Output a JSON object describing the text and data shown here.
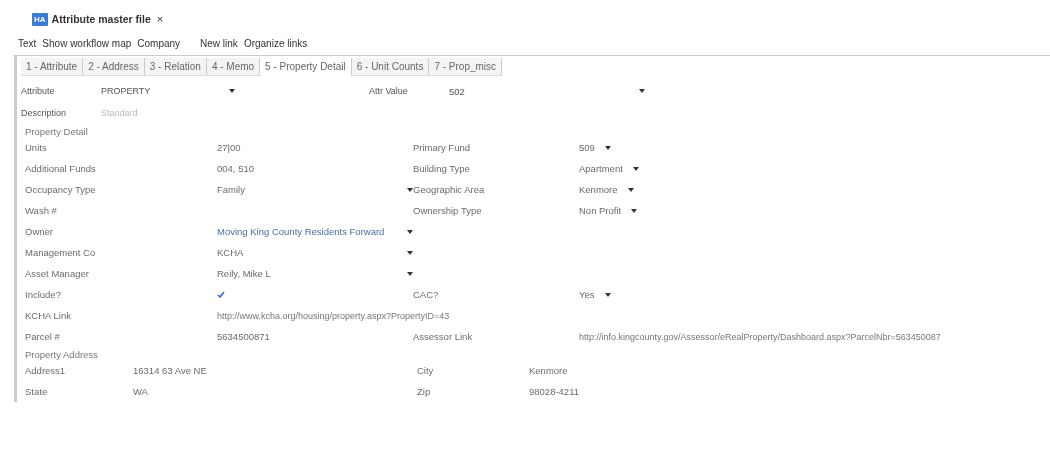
{
  "window": {
    "icon_text": "HA",
    "title": "Attribute master file",
    "close": "×"
  },
  "menu": [
    "Text",
    "Show workflow map",
    "Company",
    "New link",
    "Organize links"
  ],
  "tabs": [
    {
      "label": "1 - Attribute",
      "selected": false
    },
    {
      "label": "2 - Address",
      "selected": false
    },
    {
      "label": "3 - Relation",
      "selected": false
    },
    {
      "label": "4 - Memo",
      "selected": false
    },
    {
      "label": "5 - Property Detail",
      "selected": true
    },
    {
      "label": "6 - Unit Counts",
      "selected": false
    },
    {
      "label": "7 - Prop_misc",
      "selected": false
    }
  ],
  "header": {
    "attribute_label": "Attribute",
    "attribute_value": "PROPERTY",
    "attr_value_label": "Attr Value",
    "attr_value": "502",
    "description_label": "Description",
    "description_placeholder": "Standard"
  },
  "property_detail": {
    "title": "Property Detail",
    "rows": [
      {
        "left": {
          "label": "Units",
          "kind": "text",
          "value": "27|00"
        },
        "right": {
          "label": "Primary Fund",
          "kind": "select",
          "value": "509"
        }
      },
      {
        "left": {
          "label": "Additional Funds",
          "kind": "text",
          "value": "004, 510"
        },
        "right": {
          "label": "Building Type",
          "kind": "select",
          "value": "Apartment"
        }
      },
      {
        "left": {
          "label": "Occupancy Type",
          "kind": "select",
          "value": "Family"
        },
        "right": {
          "label": "Geographic Area",
          "kind": "select",
          "value": "Kenmore"
        }
      },
      {
        "left": {
          "label": "Wash #",
          "kind": "text"
        },
        "right": {
          "label": "Ownership Type",
          "kind": "select",
          "value": "Non Profit"
        }
      },
      {
        "left": {
          "label": "Owner",
          "kind": "select",
          "value": "Moving King County Residents Forward"
        }
      },
      {
        "left": {
          "label": "Management Co",
          "kind": "select",
          "value": "KCHA"
        }
      },
      {
        "left": {
          "label": "Asset Manager",
          "kind": "select",
          "value": "Reily, Mike L"
        }
      },
      {
        "left": {
          "label": "Include?",
          "kind": "check",
          "checked": true
        },
        "right": {
          "label": "CAC?",
          "kind": "select",
          "value": "Yes"
        }
      },
      {
        "left": {
          "label": "KCHA Link",
          "kind": "link",
          "value": "http://www.kcha.org/housing/property.aspx?PropertyID=43"
        }
      },
      {
        "left": {
          "label": "Parcel #",
          "kind": "text",
          "value": "5634500871"
        },
        "right": {
          "label": "Assessor Link",
          "kind": "link",
          "value": "http://info.kingcounty.gov/Assessor/eRealProperty/Dashboard.aspx?ParcelNbr=563450087"
        }
      }
    ]
  },
  "property_address": {
    "title": "Property Address",
    "rows": [
      {
        "left": {
          "label": "Address1",
          "value": "16314 63 Ave NE"
        },
        "right": {
          "label": "City",
          "value": "Kenmore"
        }
      },
      {
        "left": {
          "label": "State",
          "value": "WA"
        },
        "right": {
          "label": "Zip",
          "value": "98028-4211"
        }
      }
    ]
  }
}
